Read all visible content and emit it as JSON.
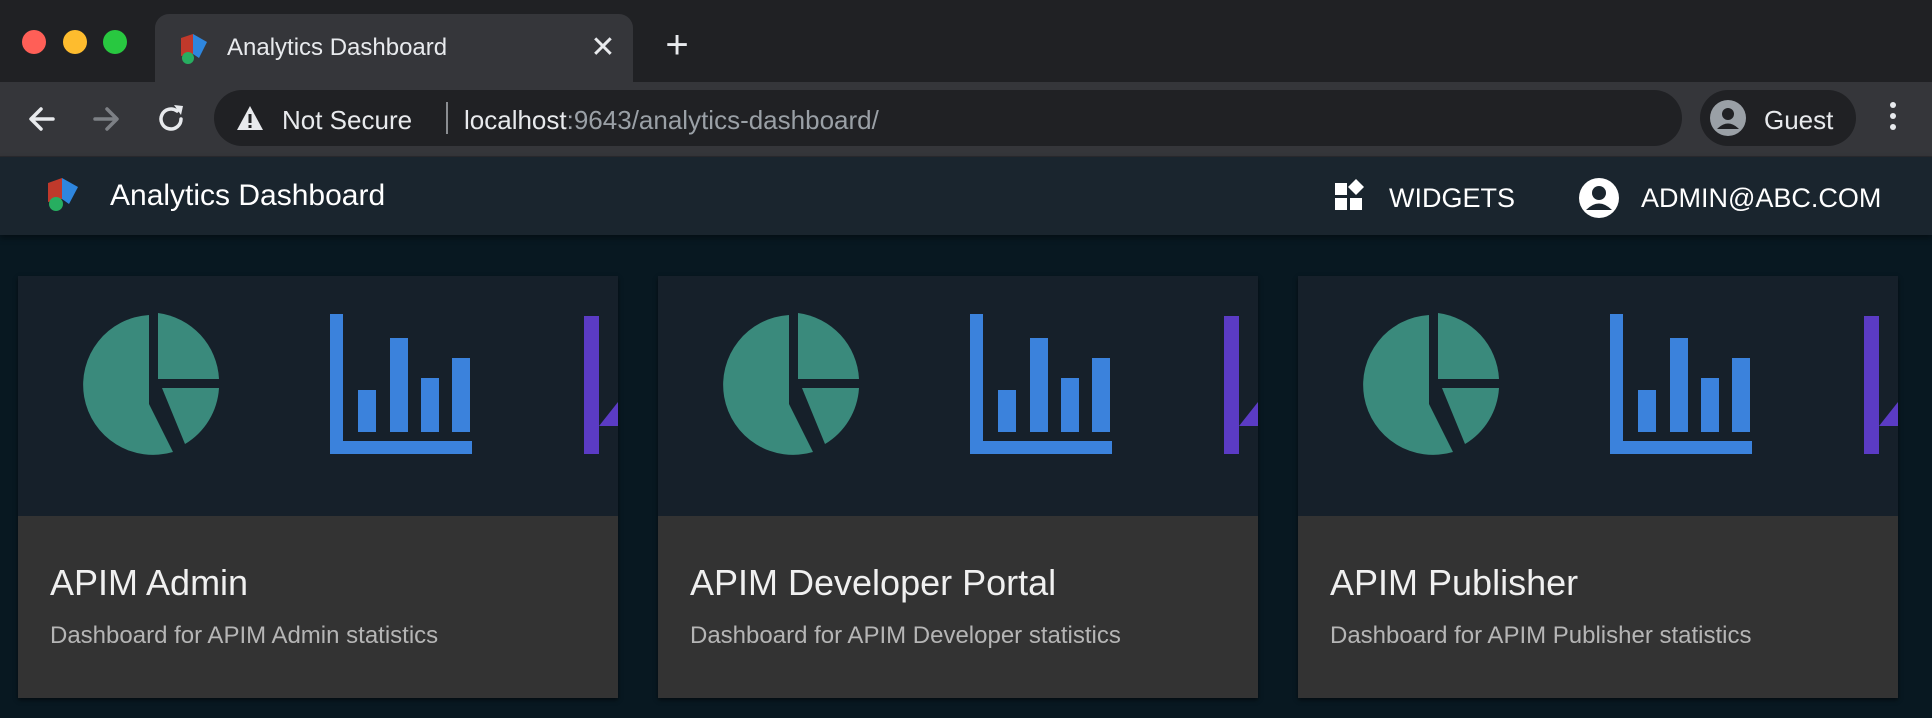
{
  "browser": {
    "tab": {
      "title": "Analytics Dashboard",
      "close_glyph": "✕"
    },
    "new_tab_glyph": "+",
    "omnibox": {
      "security_label": "Not Secure",
      "url_host": "localhost",
      "url_rest": ":9643/analytics-dashboard/"
    },
    "profile": {
      "label": "Guest"
    },
    "icons": [
      "back-arrow-icon",
      "forward-arrow-icon",
      "reload-icon",
      "warning-icon",
      "account-circle-icon",
      "more-vert-icon"
    ]
  },
  "app": {
    "title": "Analytics Dashboard",
    "nav": {
      "widgets_label": "WIDGETS",
      "user_label": "ADMIN@ABC.COM"
    }
  },
  "cards": [
    {
      "title": "APIM Admin",
      "description": "Dashboard for APIM Admin statistics"
    },
    {
      "title": "APIM Developer Portal",
      "description": "Dashboard for APIM Developer statistics"
    },
    {
      "title": "APIM Publisher",
      "description": "Dashboard for APIM Publisher statistics"
    }
  ],
  "colors": {
    "page_bg": "#081821",
    "appbar_bg": "#1a252e",
    "card_bg": "#333333",
    "card_media_bg": "#16202a",
    "pie": "#3a8a7c",
    "bars": "#3b82dc",
    "accent_purple": "#5b3bc4"
  }
}
